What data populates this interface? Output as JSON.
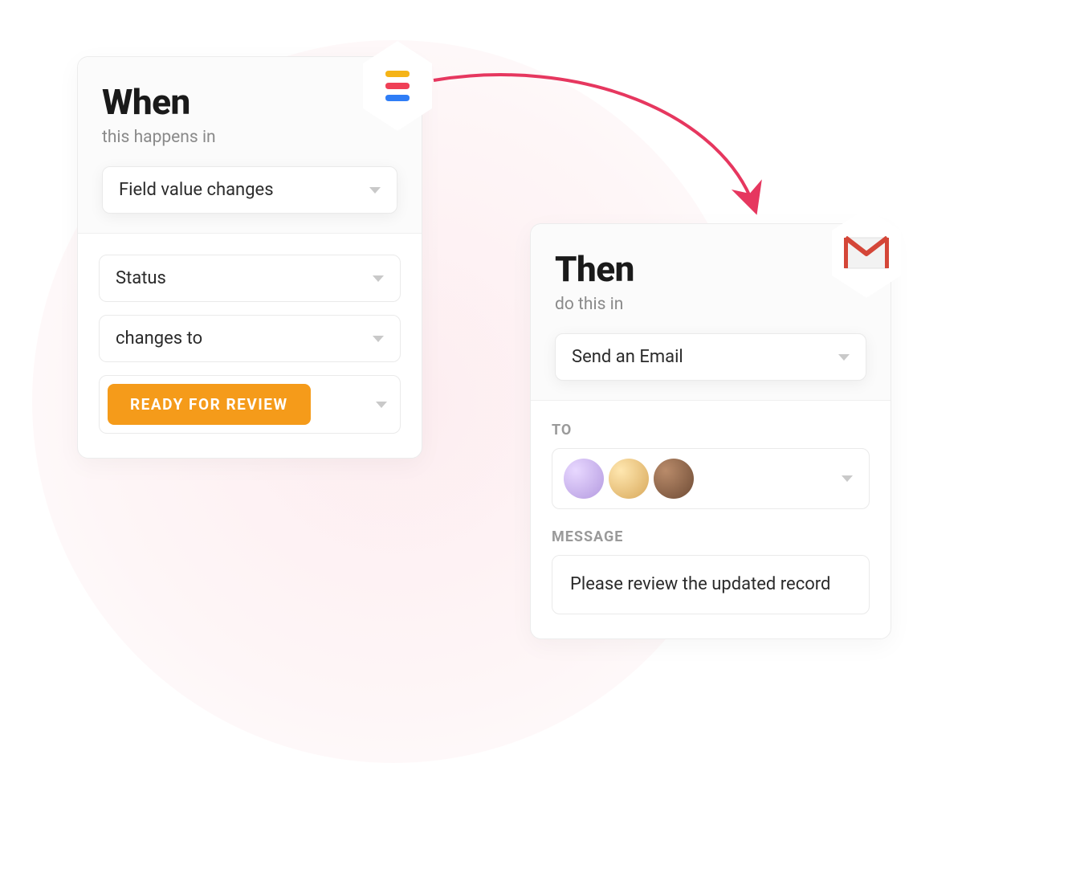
{
  "when": {
    "title": "When",
    "subtitle": "this happens in",
    "trigger": "Field value changes",
    "field": "Status",
    "condition": "changes to",
    "value": "READY FOR REVIEW",
    "icon": "smartsuite-icon"
  },
  "then": {
    "title": "Then",
    "subtitle": "do this in",
    "action": "Send an Email",
    "to_label": "TO",
    "recipients": [
      "user-1",
      "user-2",
      "user-3"
    ],
    "message_label": "MESSAGE",
    "message": "Please review the updated record",
    "icon": "gmail-icon"
  },
  "colors": {
    "accent_orange": "#f59b1a",
    "arrow": "#e6375f"
  }
}
